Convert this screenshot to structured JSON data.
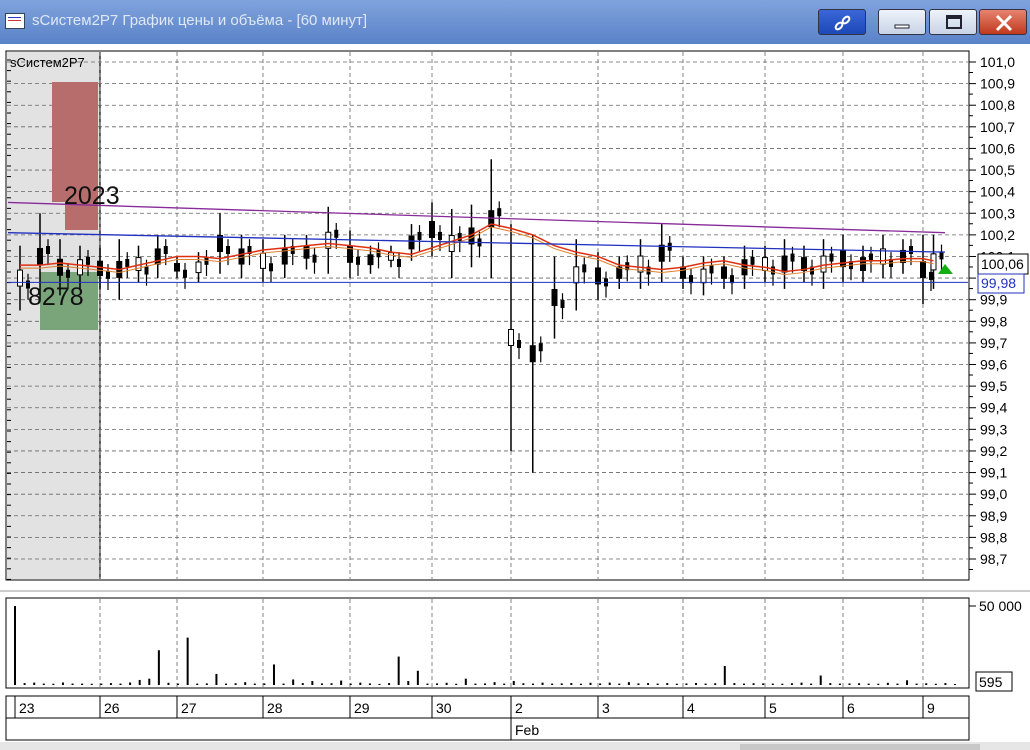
{
  "window": {
    "title": "sСистем2P7 График цены и объёма - [60 минут]"
  },
  "chart_label": "sСистем2P7",
  "colors": {
    "candle": "#000000",
    "ma_red": "#e03010",
    "ma_orange": "#e08030",
    "line_purple": "#882a9a",
    "line_blue": "#2030c0",
    "vp_red": "#b84c4c",
    "vp_green": "#3d8a3d",
    "marker_green": "#12b012",
    "grid": "#666666"
  },
  "price_axis": {
    "ticks": [
      "101,0",
      "100,9",
      "100,8",
      "100,7",
      "100,6",
      "100,5",
      "100,4",
      "100,3",
      "100,2",
      "100,1",
      "100,0",
      "99,9",
      "99,8",
      "99,7",
      "99,6",
      "99,5",
      "99,4",
      "99,3",
      "99,2",
      "99,1",
      "99,0",
      "98,9",
      "98,8",
      "98,7"
    ],
    "current_price": "100,06",
    "blue_level": "99,98"
  },
  "annotations": {
    "upper_volume": "2023",
    "lower_volume": "8278"
  },
  "volume_axis": {
    "max_label": "50 000",
    "current_label": "595"
  },
  "dates": [
    "23",
    "26",
    "27",
    "28",
    "29",
    "30",
    "2",
    "3",
    "4",
    "5",
    "6",
    "9"
  ],
  "month": "Feb",
  "chart_data": [
    {
      "type": "line",
      "title": "",
      "ylabel": "",
      "y_ticks": [
        "101,0",
        "100,9",
        "100,8",
        "100,7",
        "100,6",
        "100,5",
        "100,4",
        "100,3",
        "100,2",
        "100,1",
        "100,0",
        "99,9",
        "99,8",
        "99,7",
        "99,6",
        "99,5",
        "99,4",
        "99,3",
        "99,2",
        "99,1",
        "99,0",
        "98,9",
        "98,8",
        "98,7"
      ],
      "x_tick_labels": [
        "23",
        "26",
        "27",
        "28",
        "29",
        "30",
        "2",
        "3",
        "4",
        "5",
        "6",
        "9"
      ],
      "ylim": [
        98.7,
        101.0
      ],
      "grid": true,
      "series": [
        {
          "kind": "candles_hl",
          "x": [
            0,
            0.25,
            0.5,
            0.75,
            1,
            1.25,
            1.5,
            1.75,
            2,
            2.25,
            2.5,
            2.75,
            3,
            3.25,
            3.5,
            3.75,
            4,
            4.25,
            4.5,
            4.75,
            5,
            5.25,
            5.5,
            5.75,
            6,
            6.25,
            6.5,
            6.75,
            7,
            7.25,
            7.5,
            7.75,
            8,
            8.25,
            8.5,
            8.75,
            9,
            9.25,
            9.5,
            9.75,
            10,
            10.25,
            10.5,
            10.75,
            11,
            11.25
          ],
          "high": [
            100.15,
            100.3,
            100.18,
            100.15,
            100.14,
            100.18,
            100.15,
            100.2,
            100.1,
            100.12,
            100.3,
            100.2,
            100.18,
            100.2,
            100.2,
            100.33,
            100.22,
            100.15,
            100.15,
            100.25,
            100.35,
            100.32,
            100.34,
            100.55,
            100.25,
            100.2,
            100.1,
            100.18,
            100.12,
            100.1,
            100.18,
            100.25,
            100.1,
            100.1,
            100.1,
            100.15,
            100.15,
            100.18,
            100.15,
            100.18,
            100.2,
            100.15,
            100.2,
            100.18,
            100.2,
            100.2
          ],
          "low": [
            99.85,
            99.9,
            99.92,
            99.95,
            99.95,
            99.9,
            99.98,
            100.0,
            100.0,
            99.98,
            100.02,
            100.0,
            99.98,
            100.0,
            100.04,
            100.02,
            100.0,
            100.02,
            100.05,
            100.08,
            100.1,
            100.0,
            100.05,
            100.0,
            99.2,
            99.1,
            99.72,
            99.85,
            99.9,
            99.95,
            99.95,
            99.98,
            99.95,
            99.92,
            99.95,
            99.95,
            99.98,
            99.95,
            99.98,
            99.95,
            99.98,
            99.98,
            100.0,
            100.02,
            99.88,
            99.95
          ]
        },
        {
          "name": "",
          "kind": "ma",
          "values": [
            100.06,
            100.06,
            100.07,
            100.06,
            100.05,
            100.04,
            100.06,
            100.08,
            100.1,
            100.1,
            100.09,
            100.11,
            100.13,
            100.14,
            100.15,
            100.16,
            100.15,
            100.14,
            100.12,
            100.11,
            100.14,
            100.17,
            100.2,
            100.25,
            100.23,
            100.2,
            100.15,
            100.12,
            100.1,
            100.06,
            100.05,
            100.04,
            100.05,
            100.07,
            100.08,
            100.06,
            100.05,
            100.03,
            100.04,
            100.06,
            100.07,
            100.08,
            100.08,
            100.09,
            100.09,
            100.08
          ]
        },
        {
          "name": "",
          "kind": "trend",
          "values": [
            100.35,
            100.21
          ]
        },
        {
          "name": "",
          "kind": "trend",
          "values": [
            100.21,
            100.12
          ]
        }
      ]
    },
    {
      "type": "bar",
      "title": "",
      "ylabel": "",
      "ylim": [
        0,
        50000
      ],
      "x_tick_labels": [
        "23",
        "26",
        "27",
        "28",
        "29",
        "30",
        "2",
        "3",
        "4",
        "5",
        "6",
        "9"
      ],
      "values": [
        50000,
        1200,
        1500,
        900,
        800,
        1600,
        900,
        900,
        800,
        900,
        1200,
        900,
        1600,
        3200,
        4000,
        22000,
        1400,
        900,
        30000,
        900,
        1000,
        7000,
        900,
        1100,
        1800,
        900,
        1000,
        13000,
        900,
        3500,
        1200,
        2500,
        1000,
        1100,
        2800,
        900,
        1500,
        1000,
        700,
        1200,
        18000,
        2500,
        9000,
        900,
        1000,
        1400,
        800,
        4000,
        900,
        1000,
        1800,
        900,
        2500,
        1100,
        900,
        1500,
        900,
        1000,
        1200,
        800,
        1400,
        1000,
        1500,
        900,
        1800,
        1000,
        1200,
        900,
        1200,
        800,
        1000,
        1300,
        900,
        1100,
        12000,
        1200,
        900,
        1100,
        1000,
        900,
        800,
        1100,
        1500,
        900,
        6000,
        1200,
        900,
        1000,
        1100,
        900,
        800,
        1400,
        900,
        3000,
        900,
        1100,
        800,
        1200,
        595
      ]
    }
  ]
}
